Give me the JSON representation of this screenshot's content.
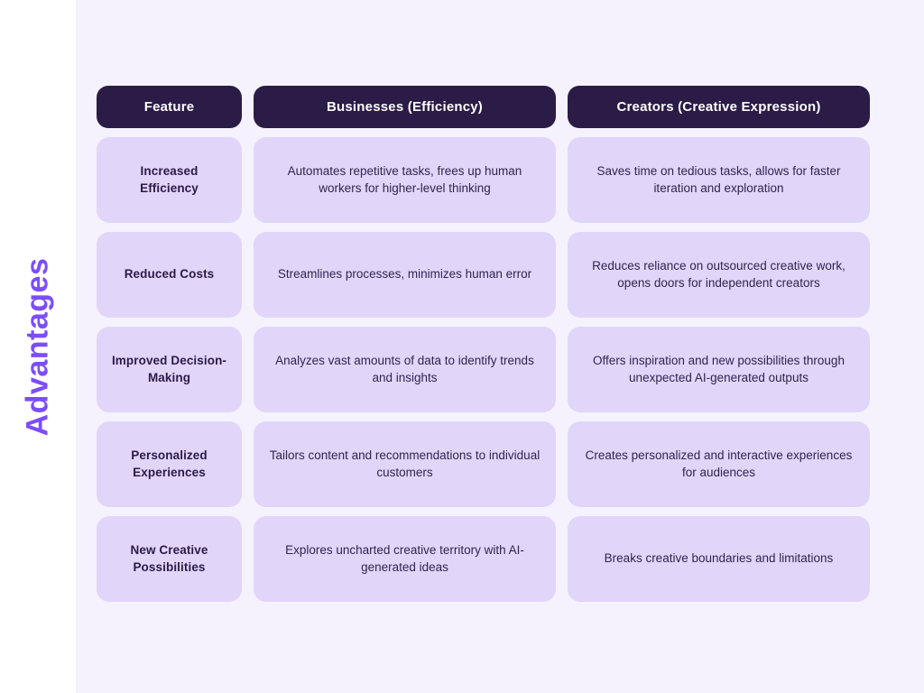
{
  "side_label": "Advantages",
  "colors": {
    "page_background": "#ffffff",
    "canvas_background": "#f5f2fd",
    "header_cell": "#2a1b47",
    "header_text": "#ffffff",
    "body_cell": "#e2d5fa",
    "body_text": "#2a1b47",
    "accent_label": "#7c4dff"
  },
  "table": {
    "headers": [
      "Feature",
      "Businesses (Efficiency)",
      "Creators (Creative Expression)"
    ],
    "rows": [
      {
        "feature": "Increased Efficiency",
        "businesses": "Automates repetitive tasks, frees up human workers for higher-level thinking",
        "creators": "Saves time on tedious tasks, allows for faster iteration and exploration"
      },
      {
        "feature": "Reduced Costs",
        "businesses": "Streamlines processes, minimizes human error",
        "creators": "Reduces reliance on outsourced creative work, opens doors for independent creators"
      },
      {
        "feature": "Improved Decision-Making",
        "businesses": "Analyzes vast amounts of data to identify trends and insights",
        "creators": "Offers inspiration and new possibilities through unexpected AI-generated outputs"
      },
      {
        "feature": "Personalized Experiences",
        "businesses": "Tailors content and recommendations to individual customers",
        "creators": "Creates personalized and interactive experiences for audiences"
      },
      {
        "feature": "New Creative Possibilities",
        "businesses": "Explores uncharted creative territory with AI-generated ideas",
        "creators": "Breaks creative boundaries and limitations"
      }
    ]
  }
}
